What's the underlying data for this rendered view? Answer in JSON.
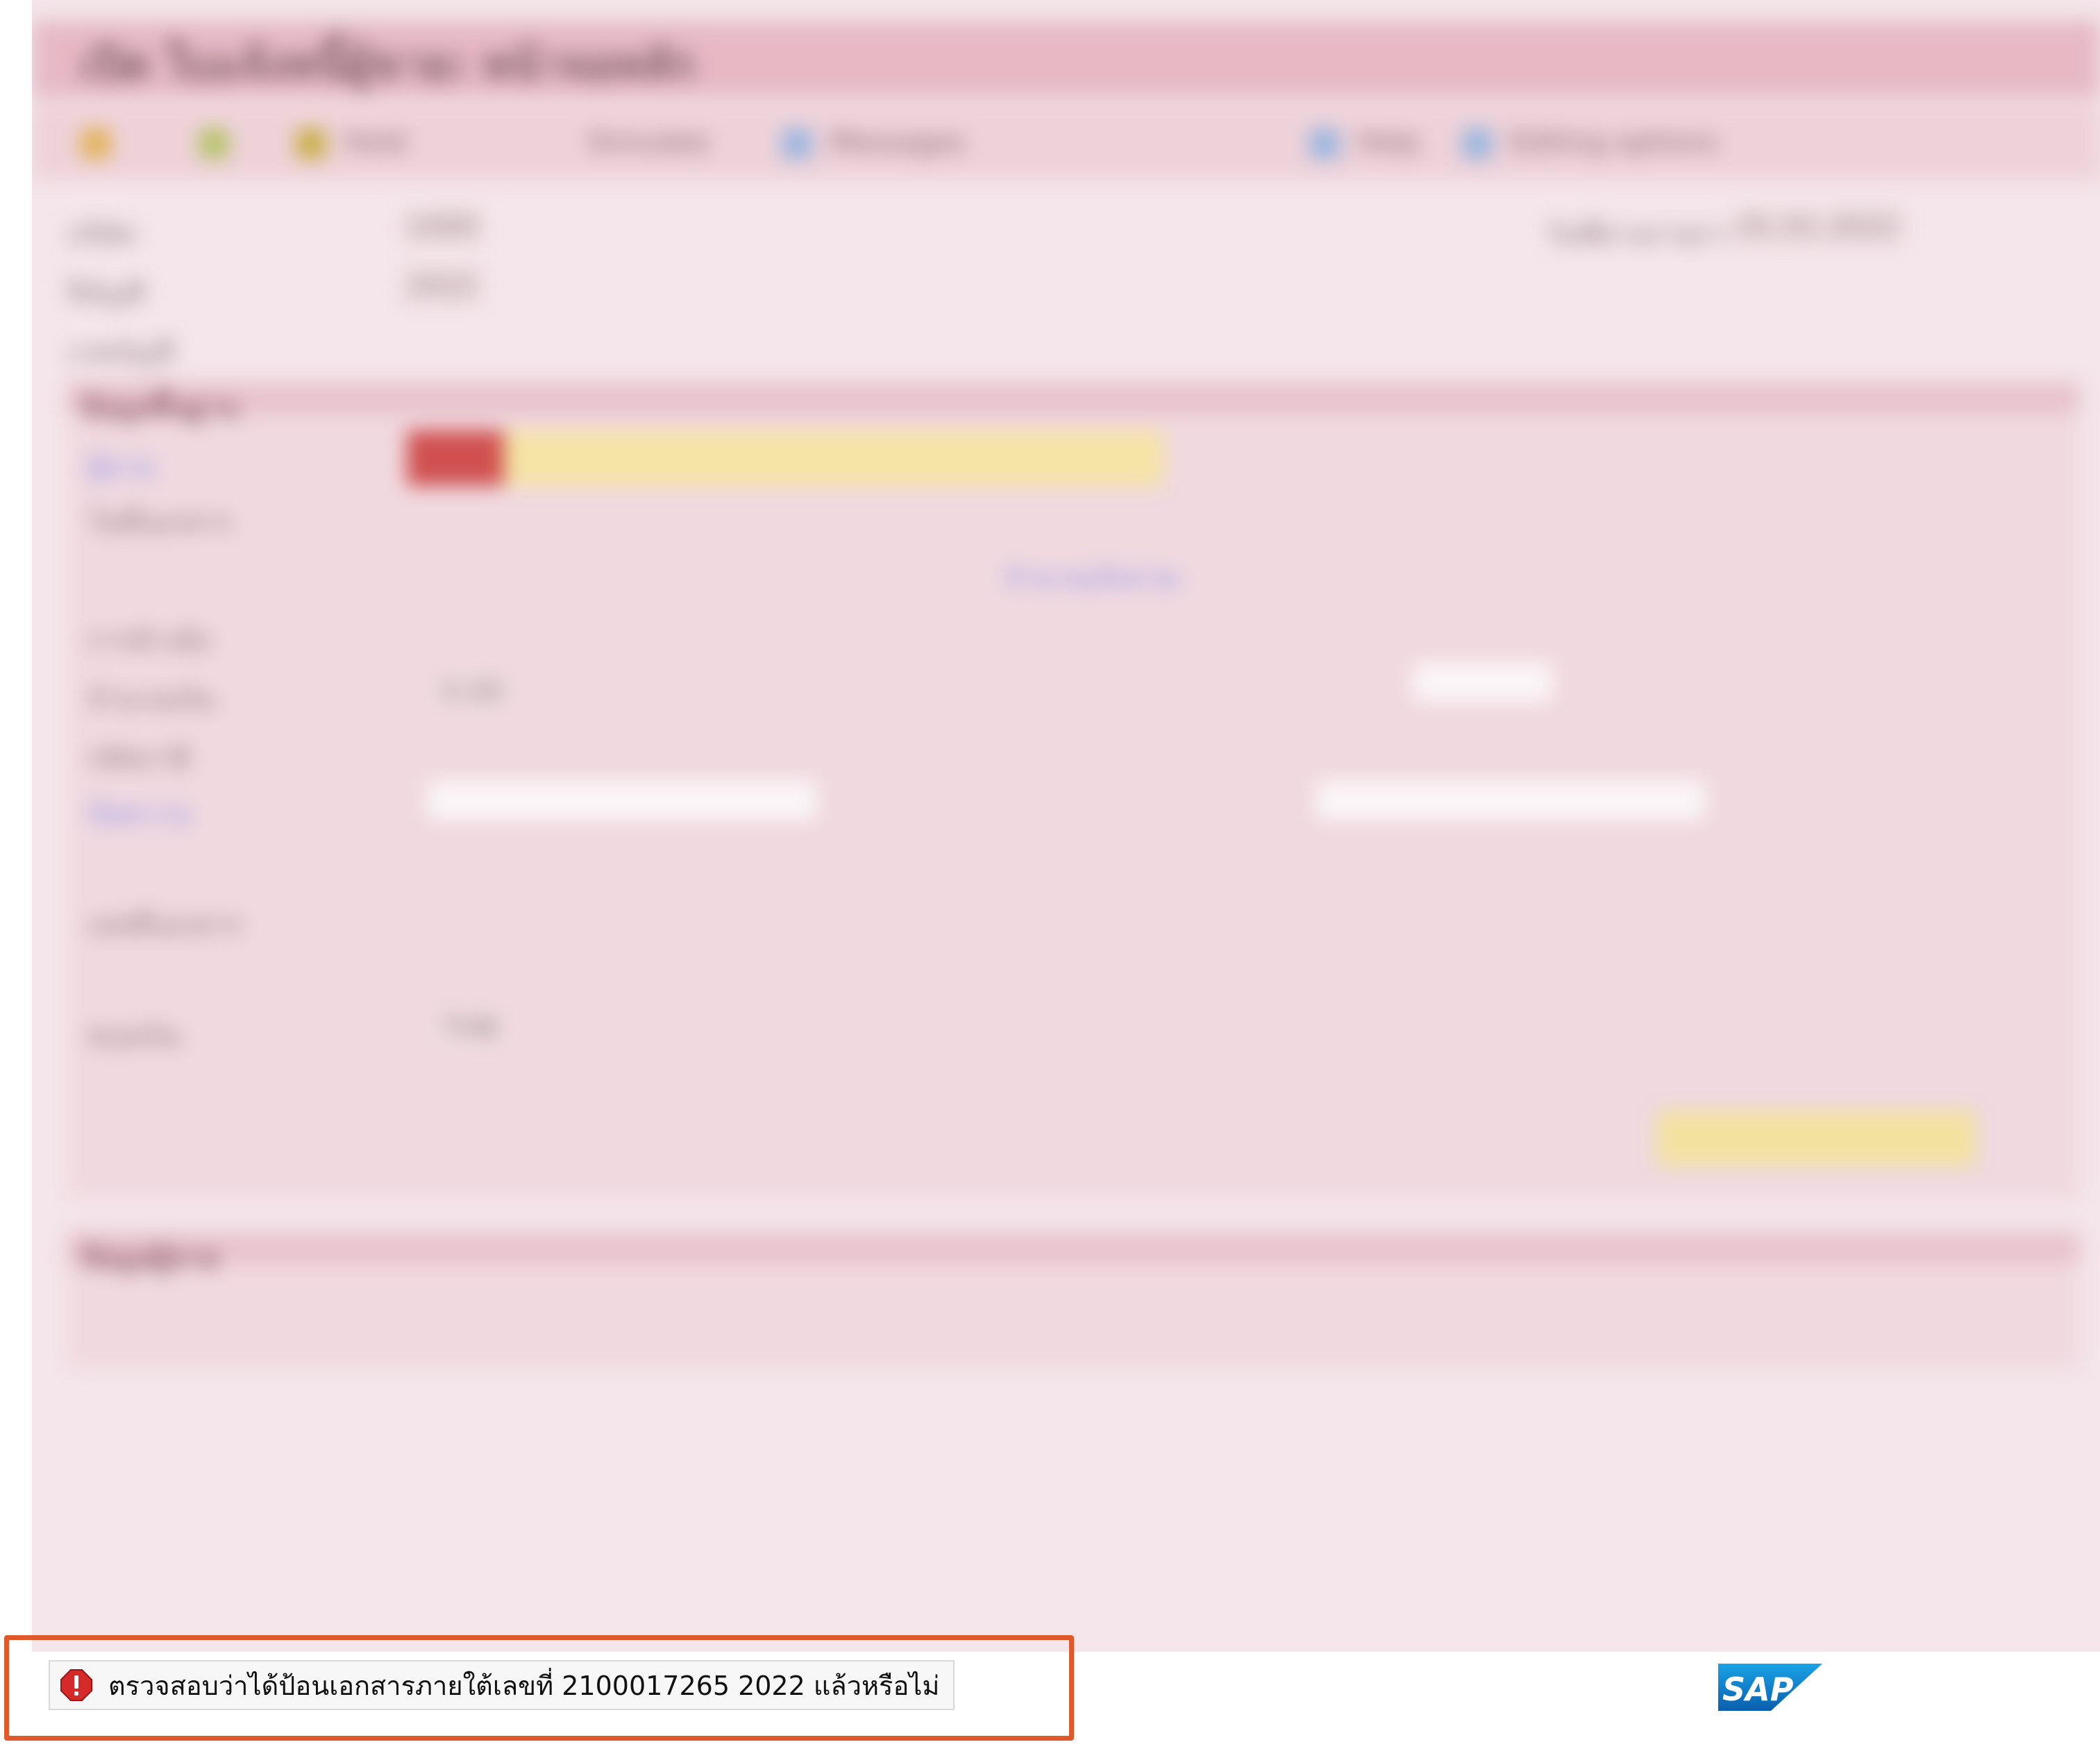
{
  "window": {
    "title": "เปิด ใบแจ้งหนี้ผู้ขาย: หน้าจอหลัก",
    "toolbar": [
      {
        "label": "",
        "icon": "tree-icon"
      },
      {
        "label": "",
        "icon": "display-icon"
      },
      {
        "label": "Hold",
        "icon": "hold-icon"
      },
      {
        "label": "Simulate",
        "icon": "simulate-icon"
      },
      {
        "label": "Messages",
        "icon": "message-icon"
      },
      {
        "label": "Help",
        "icon": "help-icon"
      },
      {
        "label": "Editing options",
        "icon": "options-icon"
      }
    ],
    "header_fields": [
      {
        "label": "บริษัท",
        "value": "1000"
      },
      {
        "label": "ปีบัญชี",
        "value": "2022"
      },
      {
        "label": "งวดบัญชี",
        "value": ""
      },
      {
        "label": "วันที่ผ่านรายการ",
        "value": "01.01.2022"
      }
    ],
    "sections": {
      "basic_data": {
        "title": "ข้อมูลพื้นฐาน",
        "fields": [
          {
            "label": "ผู้ขาย",
            "value": "",
            "link": true
          },
          {
            "label": "วันที่เอกสาร",
            "value": ""
          },
          {
            "label": "การอ้างอิง",
            "value": ""
          },
          {
            "label": "จำนวนเงิน",
            "value": "0.00"
          },
          {
            "label": "รหัสภาษี",
            "value": ""
          },
          {
            "label": "ข้อความ",
            "value": "",
            "link": true
          },
          {
            "label": "จำนวนเงินรวม",
            "value": ""
          },
          {
            "label": "เลขที่เอกสาร",
            "value": ""
          },
          {
            "label": "สกุลเงิน",
            "value": "THB"
          }
        ]
      },
      "vendor": {
        "title": "ข้อมูลผู้ขาย"
      }
    }
  },
  "status": {
    "message": "ตรวจสอบว่าได้ป้อนเอกสารภายใต้เลขที่ 2100017265 2022 แล้วหรือไม่",
    "type": "error",
    "icon": "error-icon",
    "colors": {
      "highlight_border": "#e0592a",
      "error_red": "#d42a2a"
    }
  },
  "branding": {
    "logo": "SAP"
  }
}
